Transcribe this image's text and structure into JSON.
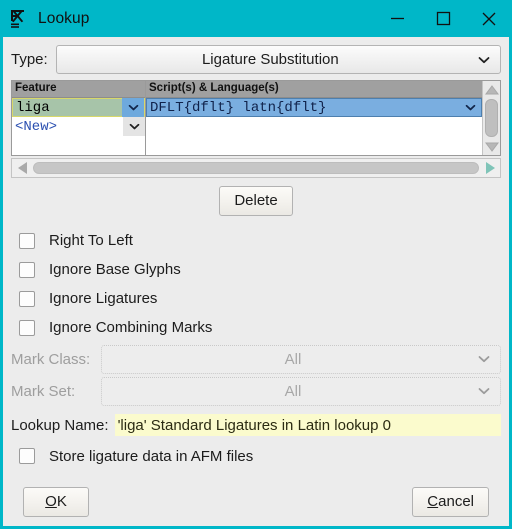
{
  "window": {
    "title": "Lookup",
    "icon": "fontforge-icon",
    "accent_color": "#00b7c8",
    "controls": {
      "minimize": "minimize-icon",
      "maximize": "maximize-icon",
      "close": "close-icon"
    }
  },
  "type_section": {
    "label": "Type:",
    "value": "Ligature Substitution"
  },
  "table": {
    "headers": [
      "Feature",
      "Script(s) & Language(s)"
    ],
    "rows": [
      {
        "feature": "liga",
        "scripts": "DFLT{dflt}  latn{dflt}"
      },
      {
        "feature": "<New>",
        "scripts": ""
      }
    ]
  },
  "delete_button": "Delete",
  "flags": [
    {
      "label": "Right To Left",
      "checked": false
    },
    {
      "label": "Ignore Base Glyphs",
      "checked": false
    },
    {
      "label": "Ignore Ligatures",
      "checked": false
    },
    {
      "label": "Ignore Combining Marks",
      "checked": false
    }
  ],
  "mark_class": {
    "label": "Mark Class:",
    "value": "All",
    "enabled": false
  },
  "mark_set": {
    "label": "Mark Set:",
    "value": "All",
    "enabled": false
  },
  "lookup_name": {
    "label": "Lookup Name:",
    "value": "'liga' Standard Ligatures in Latin lookup 0",
    "placeholder": ""
  },
  "store_afm": {
    "label": "Store ligature data in AFM files",
    "checked": false
  },
  "footer": {
    "ok_accel": "O",
    "ok_rest": "K",
    "cancel_accel": "C",
    "cancel_rest": "ancel"
  }
}
